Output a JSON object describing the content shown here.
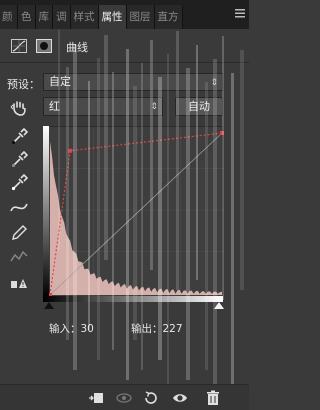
{
  "tabs": [
    {
      "label": "颜"
    },
    {
      "label": "色"
    },
    {
      "label": "库"
    },
    {
      "label": "调"
    },
    {
      "label": "样式"
    },
    {
      "label": "属性"
    },
    {
      "label": "图层"
    },
    {
      "label": "直方"
    }
  ],
  "active_tab_index": 5,
  "panel": {
    "title": "曲线"
  },
  "preset": {
    "label": "预设：",
    "value": "自定"
  },
  "channel": {
    "value": "红"
  },
  "auto_button": {
    "label": "自动"
  },
  "curve": {
    "input_label": "输入：30",
    "output_label": "输出：227",
    "points": [
      [
        0,
        0
      ],
      [
        30,
        227
      ],
      [
        255,
        255
      ]
    ],
    "curve_color": "#d9454a",
    "histogram_color": "#f0c4bd"
  },
  "icons": {
    "panel_menu": "panel-menu-icon",
    "curves_adjustment": "curves-icon",
    "mask": "mask-icon",
    "on_image_adjust": "hand-adjust-icon",
    "eyedropper_black": "eyedropper-black-icon",
    "eyedropper_gray": "eyedropper-gray-icon",
    "eyedropper_white": "eyedropper-white-icon",
    "edit_curve": "curve-edit-icon",
    "pencil": "pencil-icon",
    "smooth": "smooth-icon",
    "clipping_warning": "clipping-warning-icon",
    "clip_to_layer": "clip-to-layer-icon",
    "view_previous": "view-previous-icon",
    "reset": "reset-icon",
    "visibility": "eye-icon",
    "delete": "trash-icon"
  }
}
